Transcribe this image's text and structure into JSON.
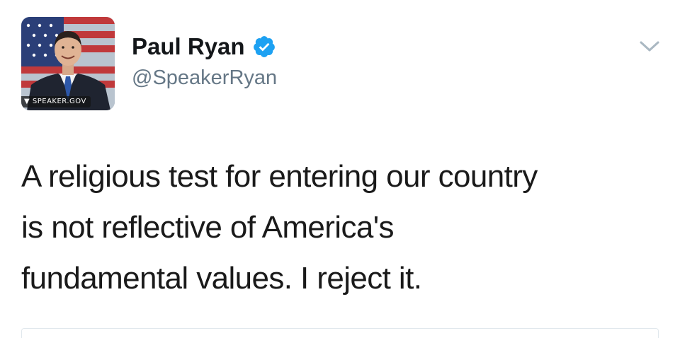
{
  "tweet": {
    "avatar": {
      "icon": "avatar-photo",
      "caption": "SPEAKER.GOV"
    },
    "author": {
      "display_name": "Paul Ryan",
      "handle": "@SpeakerRyan",
      "verified_icon": "verified-badge-icon",
      "verified_color": "#1da1f2"
    },
    "menu_icon": "chevron-down-icon",
    "text_lines": [
      "A religious test for entering our country",
      "is not reflective of America's",
      "fundamental values. I reject it."
    ]
  },
  "colors": {
    "name": "#14171a",
    "handle": "#657786",
    "text": "#1a1a1a",
    "chevron": "#aab8c2"
  }
}
